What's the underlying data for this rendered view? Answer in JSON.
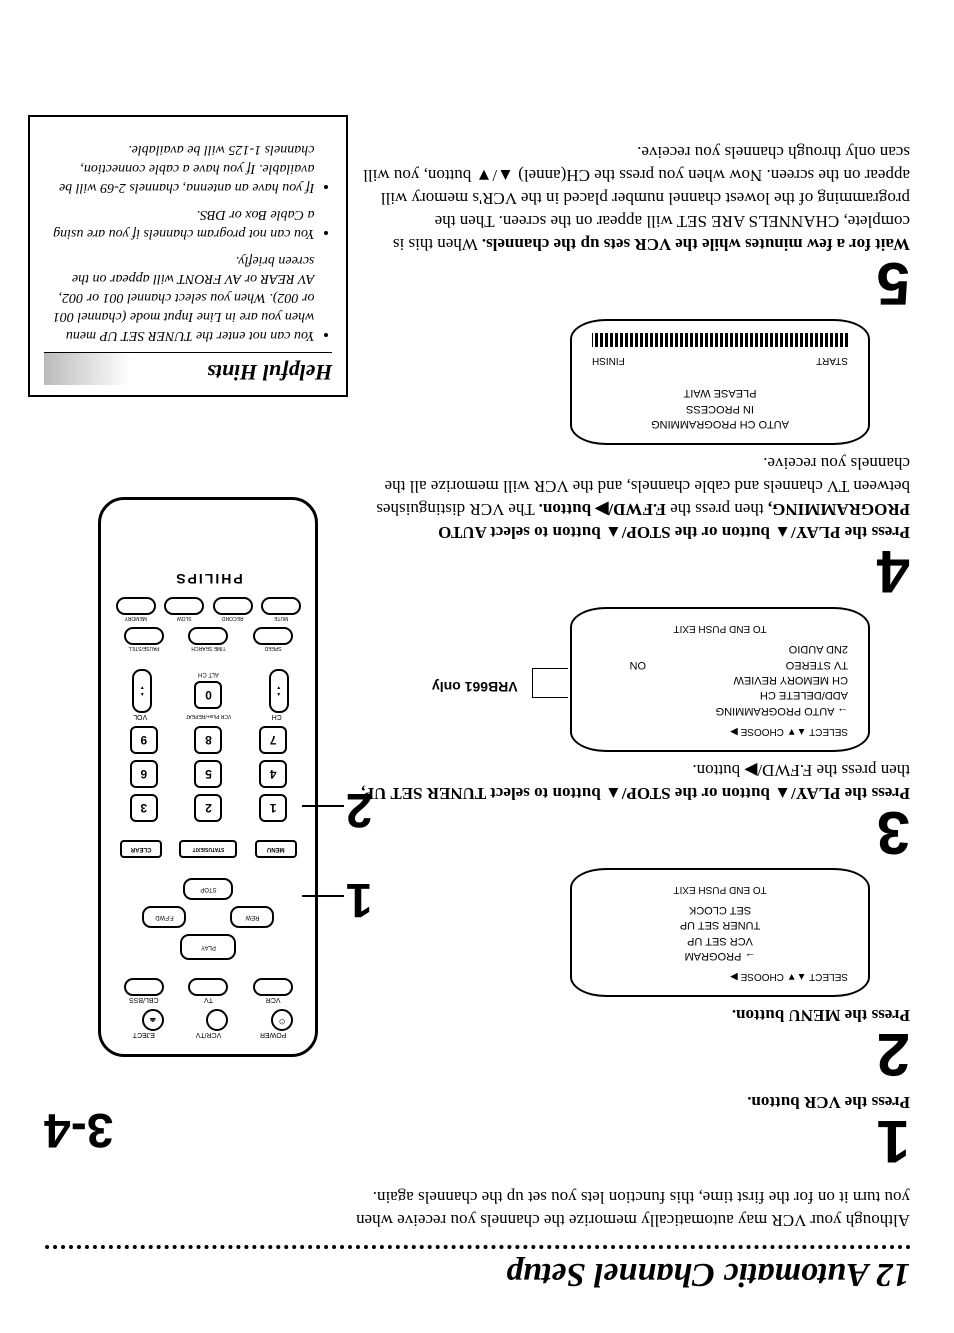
{
  "title": "12  Automatic Channel Setup",
  "intro": "Although your VCR may automatically memorize the channels you receive when you turn it on for the first time, this function lets you set up the channels again.",
  "steps": {
    "s1": {
      "num": "1",
      "text": "Press the VCR button."
    },
    "s2": {
      "num": "2",
      "text": "Press the MENU button."
    },
    "s3": {
      "num": "3",
      "text_lead": "Press the PLAY/▲ button or the STOP/▲ button to select TUNER SET UP,",
      "text_tail": " then press the F.FWD/▶ button."
    },
    "s4": {
      "num": "4",
      "text_lead": "Press the PLAY/▲ button or the STOP/▲ button to select AUTO PROGRAMMING,",
      "text_mid": " then press the ",
      "text_bold2": "F.FWD/▶ button.",
      "text_tail": " The VCR distinguishes between TV channels and cable channels, and the VCR will memorize all the channels you receive."
    },
    "s5": {
      "num": "5",
      "text_lead": "Wait for a few minutes while the VCR sets up the channels.",
      "text_tail": " When this is complete, CHANNELS ARE SET will appear on the screen. Then the programming of the lowest channel number placed in the VCR's memory will appear on the screen. Now when you press the CH(annel) ▲/▼ button, you will scan only through channels you receive."
    }
  },
  "screen_menu": {
    "header": "SELECT ▲▼ CHOOSE ▶",
    "l1": "→ PROGRAM",
    "l2": "VCR SET UP",
    "l3": "TUNER SET UP",
    "l4": "SET CLOCK",
    "footer": "TO END PUSH EXIT"
  },
  "screen_tuner": {
    "header": "SELECT ▲▼ CHOOSE ▶",
    "l1": "→ AUTO PROGRAMMING",
    "l2": "ADD/DELETE CH",
    "l3": "CH MEMORY REVIEW",
    "l4": "TV STEREO",
    "l5": "2ND AUDIO",
    "on": "ON",
    "footer": "TO END PUSH EXIT",
    "sidelabel": "VRB661 only"
  },
  "screen_prog": {
    "l1": "AUTO CH PROGRAMMING",
    "l2": "IN PROCESS",
    "l3": "PLEASE WAIT",
    "start": "START",
    "finish": "FINISH"
  },
  "hints": {
    "title": "Helpful Hints",
    "h1": "You can not enter the TUNER SET UP menu when you are in Line Input mode (channel 001 or 002). When you select channel 001 or 002, AV REAR or AV FRONT will appear on the screen briefly.",
    "h2": "You can not program channels if you are using a Cable Box or DBS.",
    "h3": "If you have an antenna, channels 2-69 will be available. If you have a cable connection, channels 1-125 will be available."
  },
  "remote": {
    "brand": "PHILIPS",
    "play": "PLAY",
    "rew": "REW",
    "ffwd": "F.FWD",
    "stop": "STOP",
    "menu": "MENU",
    "status": "STATUS/EXIT",
    "clear": "CLEAR",
    "power": "POWER",
    "vcrtv": "VCR/TV",
    "eject": "EJECT",
    "vcr_label": "VCR",
    "tv_label": "TV",
    "cblbss": "CBL/BSS",
    "mute": "MUTE",
    "record": "RECORD",
    "slow": "SLOW",
    "memory": "MEMORY",
    "speed": "SPEED",
    "timesearch": "TIME SEARCH",
    "pause": "PAUSE/STILL",
    "ch": "CH",
    "vol": "VOL",
    "altch": "ALT CH",
    "vcrplus": "VCR Plus+/REPEAT"
  },
  "callouts": {
    "c1": "1",
    "c2": "2",
    "c34": "3-4"
  }
}
